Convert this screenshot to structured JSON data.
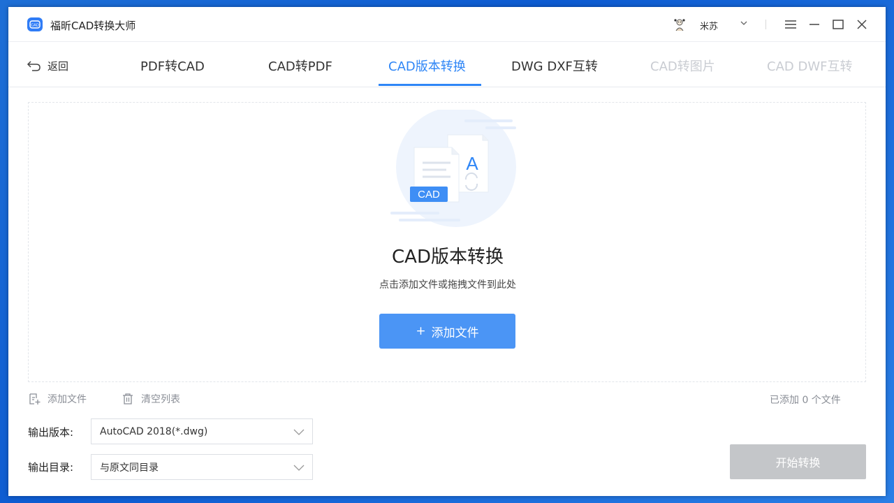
{
  "app": {
    "title": "福昕CAD转换大师",
    "logo_text": "CAD"
  },
  "user": {
    "name": "米苏"
  },
  "nav": {
    "back_label": "返回",
    "tabs": [
      {
        "label": "PDF转CAD",
        "state": "normal"
      },
      {
        "label": "CAD转PDF",
        "state": "normal"
      },
      {
        "label": "CAD版本转换",
        "state": "active"
      },
      {
        "label": "DWG DXF互转",
        "state": "normal"
      },
      {
        "label": "CAD转图片",
        "state": "disabled"
      },
      {
        "label": "CAD DWF互转",
        "state": "disabled"
      }
    ]
  },
  "dropzone": {
    "badge": "CAD",
    "doc_letter": "A",
    "title": "CAD版本转换",
    "subtitle": "点击添加文件或拖拽文件到此处",
    "add_button": "添加文件",
    "add_button_prefix": "+"
  },
  "toolbar": {
    "add_files": "添加文件",
    "clear_list": "清空列表",
    "count_text": "已添加 0 个文件"
  },
  "settings": {
    "version_label": "输出版本:",
    "version_value": "AutoCAD 2018(*.dwg)",
    "dir_label": "输出目录:",
    "dir_value": "与原文同目录"
  },
  "actions": {
    "start": "开始转换"
  },
  "colors": {
    "accent": "#2f86f6",
    "button_blue": "#4b95f5",
    "disabled_button": "#c4c6c9",
    "disabled_tab": "#c9ccd2"
  }
}
